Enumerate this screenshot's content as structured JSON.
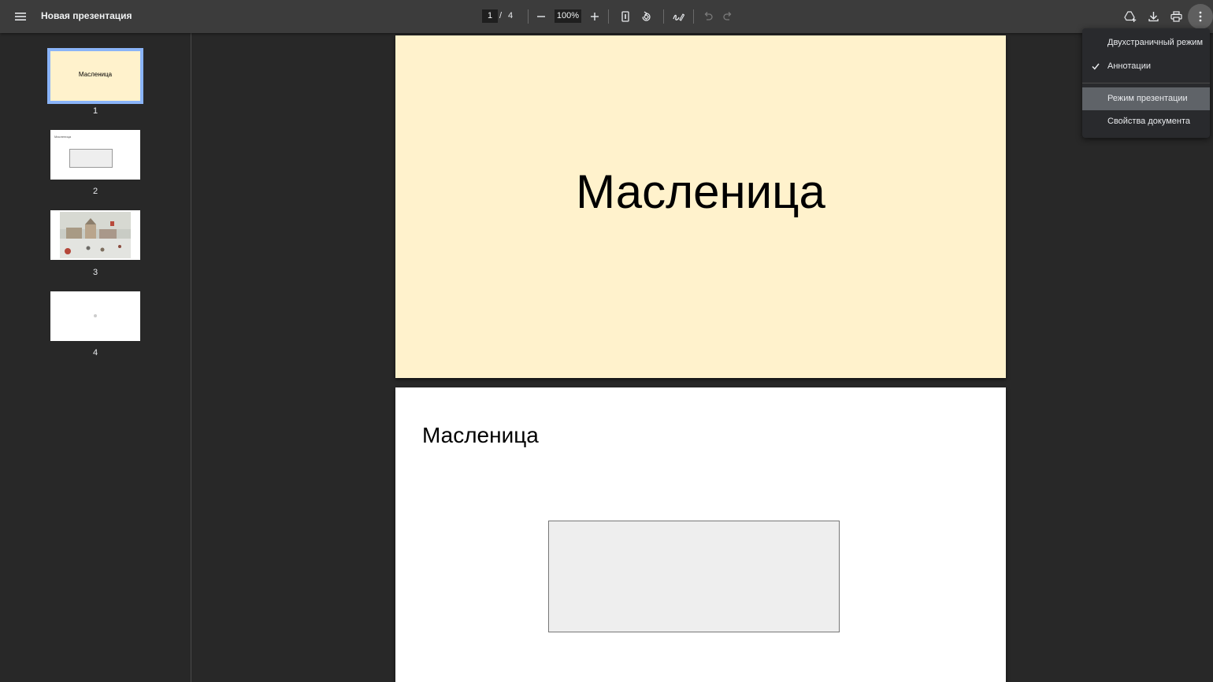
{
  "toolbar": {
    "title": "Новая презентация",
    "current_page": "1",
    "page_separator": "/",
    "total_pages": "4",
    "zoom": "100%"
  },
  "menu": {
    "items": [
      {
        "label": "Двухстраничный режим",
        "checked": false
      },
      {
        "label": "Аннотации",
        "checked": true
      },
      {
        "label": "Режим презентации",
        "checked": false,
        "highlighted": true
      },
      {
        "label": "Свойства документа",
        "checked": false
      }
    ]
  },
  "thumbnails": [
    {
      "number": "1",
      "text": "Масленица",
      "background": "#fff2cc",
      "active": true
    },
    {
      "number": "2",
      "text": "Масленица",
      "background": "#ffffff",
      "active": false
    },
    {
      "number": "3",
      "text": "",
      "background": "#ffffff",
      "active": false
    },
    {
      "number": "4",
      "text": "",
      "background": "#ffffff",
      "active": false
    }
  ],
  "pages": [
    {
      "title": "Масленица",
      "background": "#fff2cc"
    },
    {
      "title": "Масленица",
      "background": "#ffffff",
      "placeholder_fill": "#eeeeee"
    }
  ],
  "colors": {
    "toolbar_bg": "#3c3c3c",
    "viewer_bg": "#282828",
    "active_thumb_outline": "#8ab4f8",
    "menu_bg": "#292a2d",
    "menu_highlight": "#5f6368"
  }
}
